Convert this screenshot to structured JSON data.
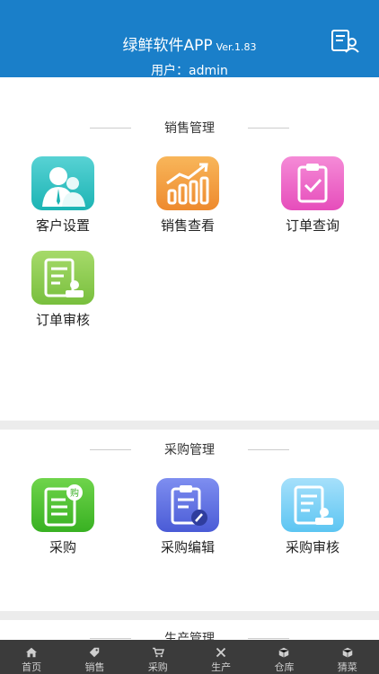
{
  "header": {
    "app_title": "绿鲜软件APP",
    "version": "Ver.1.83",
    "user_label": "用户：admin"
  },
  "sections": {
    "sales": {
      "title": "销售管理",
      "items": [
        {
          "label": "客户设置",
          "icon": "customer-icon"
        },
        {
          "label": "销售查看",
          "icon": "sales-chart-icon"
        },
        {
          "label": "订单查询",
          "icon": "order-check-icon"
        },
        {
          "label": "订单审核",
          "icon": "order-review-icon"
        }
      ]
    },
    "purchase": {
      "title": "采购管理",
      "items": [
        {
          "label": "采购",
          "icon": "purchase-icon"
        },
        {
          "label": "采购编辑",
          "icon": "purchase-edit-icon"
        },
        {
          "label": "采购审核",
          "icon": "purchase-review-icon"
        }
      ]
    },
    "production": {
      "title": "生产管理"
    }
  },
  "tabbar": [
    {
      "label": "首页",
      "icon": "home-icon"
    },
    {
      "label": "销售",
      "icon": "tag-icon"
    },
    {
      "label": "采购",
      "icon": "cart-icon"
    },
    {
      "label": "生产",
      "icon": "tools-icon"
    },
    {
      "label": "仓库",
      "icon": "box-icon"
    },
    {
      "label": "猜菜",
      "icon": "cube-icon"
    }
  ],
  "colors": {
    "header_bg": "#1a7fc9",
    "tabbar_bg": "#3b3b3b"
  }
}
